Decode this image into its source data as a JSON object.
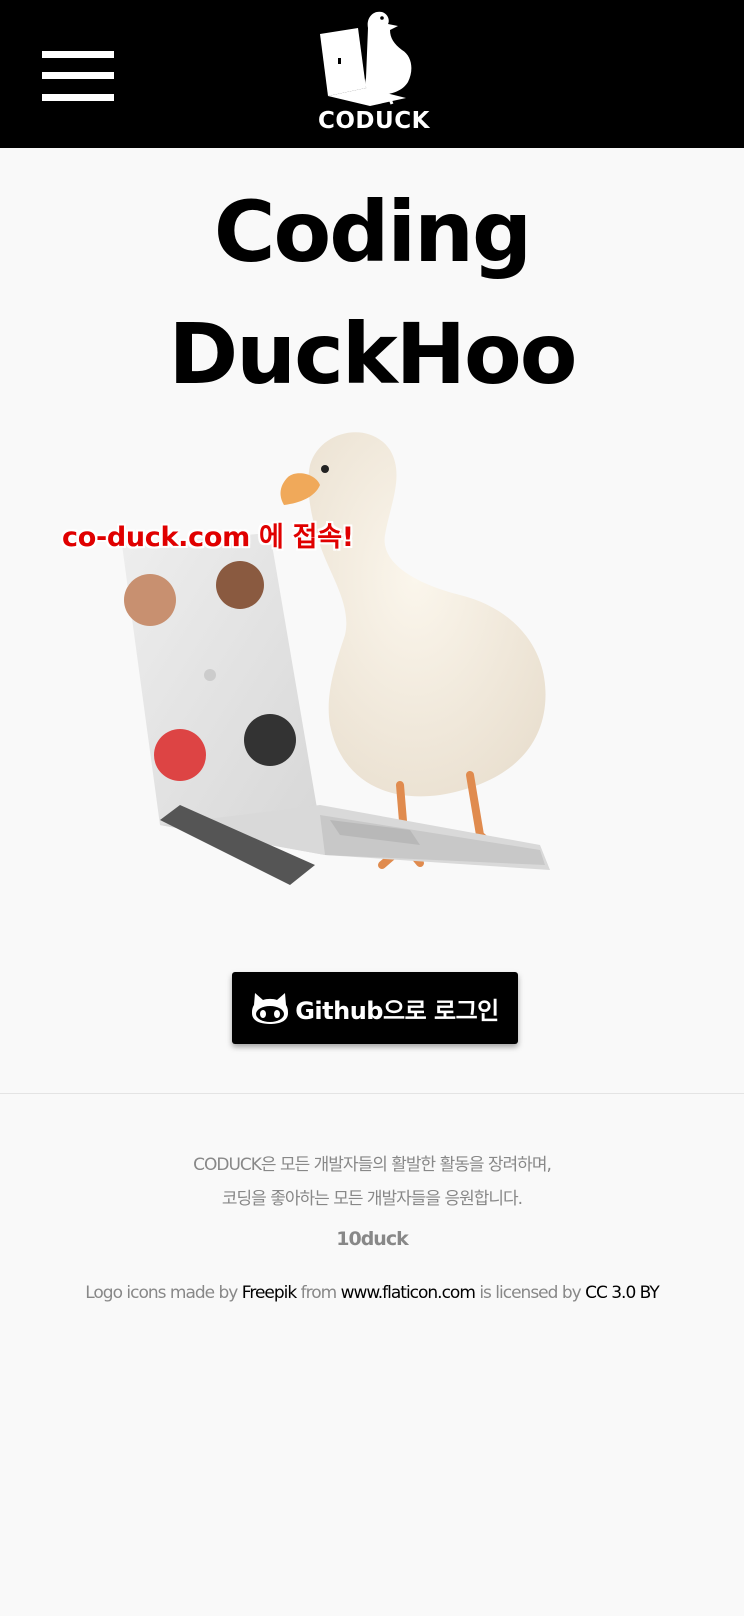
{
  "header": {
    "menu_icon": "hamburger-menu-icon",
    "logo_icon": "duck-laptop-logo-icon",
    "logo_text": "CODUCK"
  },
  "hero": {
    "title_line1": "Coding",
    "title_line2": "DuckHoo",
    "image": "duck-with-laptop-illustration",
    "promo_text": "co-duck.com 에 접속!"
  },
  "login": {
    "icon": "github-octocat-icon",
    "label": "Github으로 로그인"
  },
  "footer": {
    "line1": "CODUCK은 모든 개발자들의 활발한 활동을 장려하며,",
    "line2": "코딩을 좋아하는 모든 개발자들을 응원합니다.",
    "team": "10duck",
    "credit_prefix": "Logo icons made by",
    "credit_author": "Freepik",
    "credit_from": "from",
    "credit_site": "www.flaticon.com",
    "credit_licensed": "is licensed by",
    "credit_license": "CC 3.0 BY"
  },
  "colors": {
    "header_bg": "#000000",
    "page_bg": "#f9f9f9",
    "promo": "#e00000",
    "footer_text": "#888888"
  }
}
